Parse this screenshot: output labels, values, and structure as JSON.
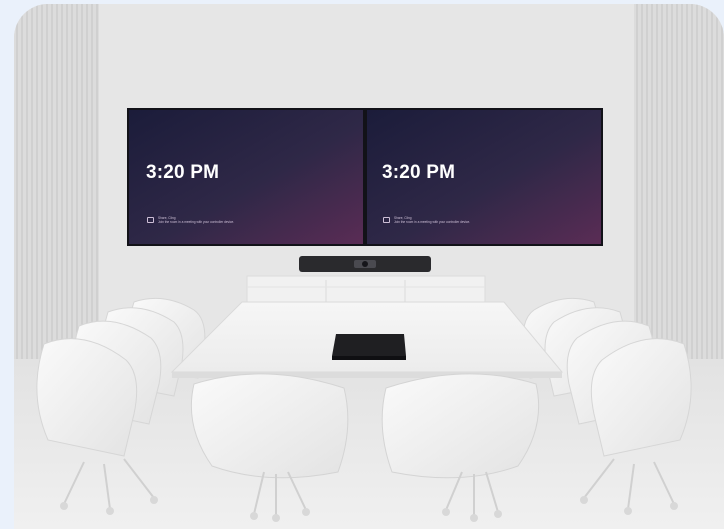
{
  "screens": [
    {
      "time": "3:20 PM",
      "notice_title": "Share, Cling",
      "notice_body": "Join the room in a meeting with your controller device."
    },
    {
      "time": "3:20 PM",
      "notice_title": "Share, Cling",
      "notice_body": "Join the room in a meeting with your controller device."
    }
  ],
  "icons": {
    "notice": "share-screen-icon",
    "video_bar": "video-bar-icon",
    "controller": "touch-controller-icon"
  },
  "colors": {
    "page_background": "#eaf1fb",
    "wall": "#e7e7e7",
    "screen_dark": "#1e1f3d",
    "screen_purple": "#4c2a4f",
    "furniture": "#f3f3f3"
  }
}
